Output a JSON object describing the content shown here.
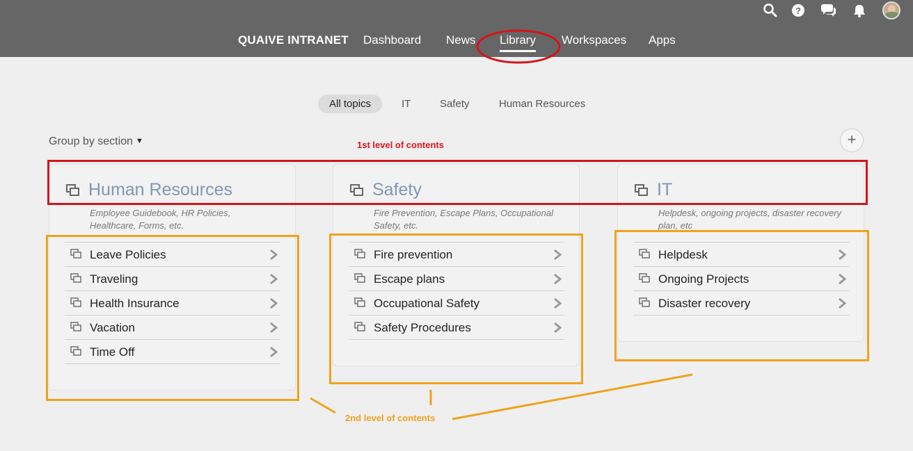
{
  "nav": {
    "brand": "QUAIVE INTRANET",
    "items": [
      "Dashboard",
      "News",
      "Library",
      "Workspaces",
      "Apps"
    ],
    "active": "Library",
    "icons": [
      "search-icon",
      "help-icon",
      "chat-icon",
      "bell-icon",
      "avatar"
    ]
  },
  "topics": [
    "All topics",
    "IT",
    "Safety",
    "Human Resources"
  ],
  "groupby": {
    "label": "Group by section"
  },
  "add_button": "+",
  "cards": [
    {
      "title": "Human Resources",
      "desc": "Employee Guidebook, HR Policies, Healthcare, Forms, etc.",
      "items": [
        "Leave Policies",
        "Traveling",
        "Health Insurance",
        "Vacation",
        "Time Off"
      ]
    },
    {
      "title": "Safety",
      "desc": "Fire Prevention, Escape Plans, Occupational Safety, etc.",
      "items": [
        "Fire prevention",
        "Escape plans",
        "Occupational Safety",
        "Safety Procedures"
      ]
    },
    {
      "title": "IT",
      "desc": "Helpdesk, ongoing projects, disaster recovery plan, etc",
      "items": [
        "Helpdesk",
        "Ongoing Projects",
        "Disaster recovery"
      ]
    }
  ],
  "annotations": {
    "first_level": "1st level of contents",
    "second_level": "2nd level of contents",
    "red": "#d6141a",
    "orange": "#f0a21e"
  }
}
